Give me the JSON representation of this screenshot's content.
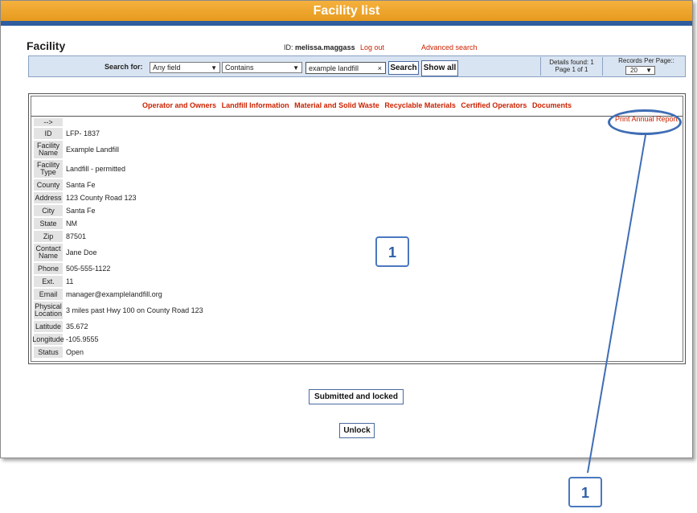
{
  "window": {
    "title": "Facility list"
  },
  "header": {
    "page_title": "Facility",
    "user_prefix": "ID:",
    "username": "melissa.maggass",
    "logout_label": "Log out",
    "advanced_search_label": "Advanced search"
  },
  "search": {
    "label": "Search for:",
    "field_value": "Any field",
    "operator_value": "Contains",
    "query_value": "example landfill",
    "search_button": "Search",
    "show_all_button": "Show all",
    "details_found": "Details found: 1",
    "page_info": "Page 1 of 1",
    "records_per_page_label": "Records Per Page::",
    "records_per_page_value": "20"
  },
  "tabs": [
    "Operator and Owners",
    "Landfill Information",
    "Material and Solid Waste",
    "Recyclable Materials",
    "Certified Operators",
    "Documents"
  ],
  "expand_arrow": "-->",
  "print_report_label": "Print Annual Report",
  "facility": {
    "id_label": "ID",
    "id_value": "LFP- 1837",
    "name_label": "Facility Name",
    "name_value": "Example Landfill",
    "type_label": "Facility Type",
    "type_value": "Landfill - permitted",
    "county_label": "County",
    "county_value": "Santa Fe",
    "address_label": "Address",
    "address_value": "123 County Road 123",
    "city_label": "City",
    "city_value": "Santa Fe",
    "state_label": "State",
    "state_value": "NM",
    "zip_label": "Zip",
    "zip_value": "87501",
    "contact_label": "Contact Name",
    "contact_value": "Jane Doe",
    "phone_label": "Phone",
    "phone_value": "505-555-1122",
    "ext_label": "Ext.",
    "ext_value": "11",
    "email_label": "Email",
    "email_value": "manager@examplelandfill.org",
    "location_label": "Physical Location",
    "location_value": "3 miles past Hwy 100 on County Road 123",
    "lat_label": "Latitude",
    "lat_value": "35.672",
    "lon_label": "Longitude",
    "lon_value": "-105.9555",
    "status_label": "Status",
    "status_value": "Open"
  },
  "actions": {
    "submitted_label": "Submitted and locked",
    "unlock_label": "Unlock"
  },
  "callouts": {
    "center": "1",
    "bottom": "1"
  },
  "colors": {
    "accent_orange": "#e79a1e",
    "link_red": "#cc2200",
    "callout_blue": "#3f6db5"
  }
}
